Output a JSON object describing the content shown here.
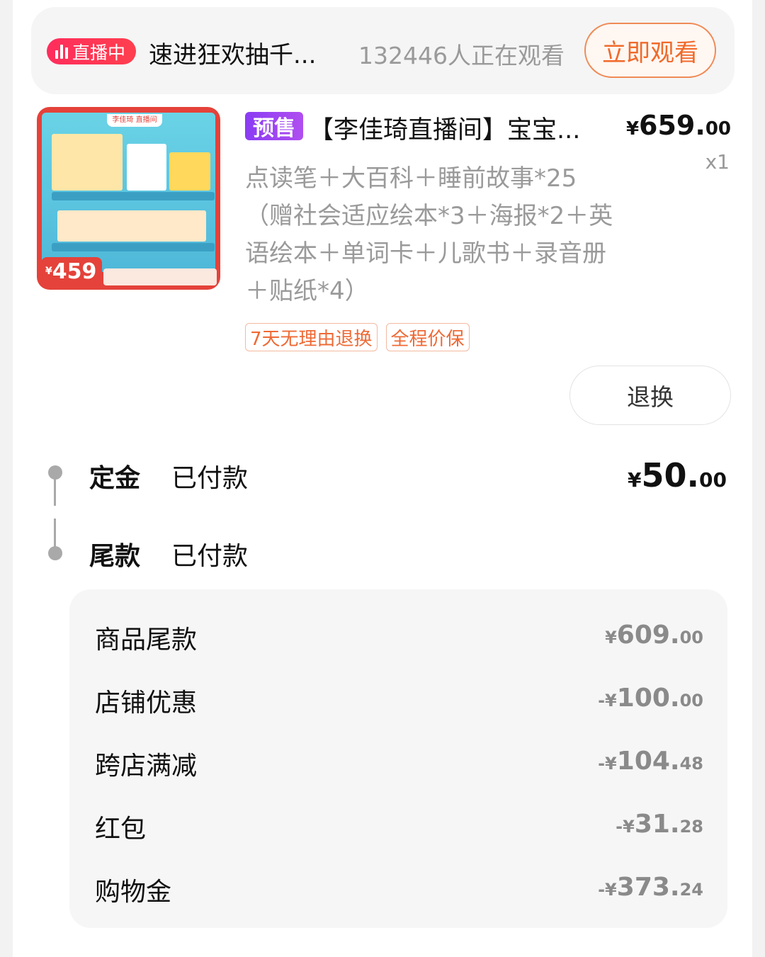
{
  "live": {
    "badge": "直播中",
    "title": "速进狂欢抽千...",
    "viewers": "132446人正在观看",
    "watch_button": "立即观看"
  },
  "product": {
    "image_price_symbol": "¥",
    "image_price": "459",
    "presale_tag": "预售",
    "title": "【李佳琦直播间】宝宝...",
    "price_symbol": "¥",
    "price_int": "659.",
    "price_cents": "00",
    "quantity": "x1",
    "sku": "点读笔＋大百科＋睡前故事*25（赠社会适应绘本*3＋海报*2＋英语绘本＋单词卡＋儿歌书＋录音册＋贴纸*4）",
    "service_tags": [
      "7天无理由退换",
      "全程价保"
    ],
    "refund_button": "退换"
  },
  "payment": {
    "deposit": {
      "label": "定金",
      "status": "已付款",
      "symbol": "¥",
      "amount_int": "50.",
      "amount_cents": "00"
    },
    "balance": {
      "label": "尾款",
      "status": "已付款"
    }
  },
  "breakdown": [
    {
      "label": "商品尾款",
      "prefix": "¥",
      "int": "609.",
      "cents": "00"
    },
    {
      "label": "店铺优惠",
      "prefix": "-¥",
      "int": "100.",
      "cents": "00"
    },
    {
      "label": "跨店满减",
      "prefix": "-¥",
      "int": "104.",
      "cents": "48"
    },
    {
      "label": "红包",
      "prefix": "-¥",
      "int": "31.",
      "cents": "28"
    },
    {
      "label": "购物金",
      "prefix": "-¥",
      "int": "373.",
      "cents": "24"
    }
  ]
}
